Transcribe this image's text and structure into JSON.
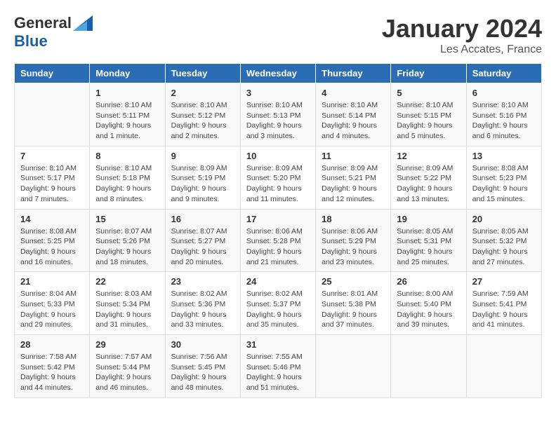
{
  "header": {
    "logo_general": "General",
    "logo_blue": "Blue",
    "month_title": "January 2024",
    "location": "Les Accates, France"
  },
  "columns": [
    "Sunday",
    "Monday",
    "Tuesday",
    "Wednesday",
    "Thursday",
    "Friday",
    "Saturday"
  ],
  "weeks": [
    [
      {
        "day": "",
        "info": ""
      },
      {
        "day": "1",
        "info": "Sunrise: 8:10 AM\nSunset: 5:11 PM\nDaylight: 9 hours\nand 1 minute."
      },
      {
        "day": "2",
        "info": "Sunrise: 8:10 AM\nSunset: 5:12 PM\nDaylight: 9 hours\nand 2 minutes."
      },
      {
        "day": "3",
        "info": "Sunrise: 8:10 AM\nSunset: 5:13 PM\nDaylight: 9 hours\nand 3 minutes."
      },
      {
        "day": "4",
        "info": "Sunrise: 8:10 AM\nSunset: 5:14 PM\nDaylight: 9 hours\nand 4 minutes."
      },
      {
        "day": "5",
        "info": "Sunrise: 8:10 AM\nSunset: 5:15 PM\nDaylight: 9 hours\nand 5 minutes."
      },
      {
        "day": "6",
        "info": "Sunrise: 8:10 AM\nSunset: 5:16 PM\nDaylight: 9 hours\nand 6 minutes."
      }
    ],
    [
      {
        "day": "7",
        "info": "Sunrise: 8:10 AM\nSunset: 5:17 PM\nDaylight: 9 hours\nand 7 minutes."
      },
      {
        "day": "8",
        "info": "Sunrise: 8:10 AM\nSunset: 5:18 PM\nDaylight: 9 hours\nand 8 minutes."
      },
      {
        "day": "9",
        "info": "Sunrise: 8:09 AM\nSunset: 5:19 PM\nDaylight: 9 hours\nand 9 minutes."
      },
      {
        "day": "10",
        "info": "Sunrise: 8:09 AM\nSunset: 5:20 PM\nDaylight: 9 hours\nand 11 minutes."
      },
      {
        "day": "11",
        "info": "Sunrise: 8:09 AM\nSunset: 5:21 PM\nDaylight: 9 hours\nand 12 minutes."
      },
      {
        "day": "12",
        "info": "Sunrise: 8:09 AM\nSunset: 5:22 PM\nDaylight: 9 hours\nand 13 minutes."
      },
      {
        "day": "13",
        "info": "Sunrise: 8:08 AM\nSunset: 5:23 PM\nDaylight: 9 hours\nand 15 minutes."
      }
    ],
    [
      {
        "day": "14",
        "info": "Sunrise: 8:08 AM\nSunset: 5:25 PM\nDaylight: 9 hours\nand 16 minutes."
      },
      {
        "day": "15",
        "info": "Sunrise: 8:07 AM\nSunset: 5:26 PM\nDaylight: 9 hours\nand 18 minutes."
      },
      {
        "day": "16",
        "info": "Sunrise: 8:07 AM\nSunset: 5:27 PM\nDaylight: 9 hours\nand 20 minutes."
      },
      {
        "day": "17",
        "info": "Sunrise: 8:06 AM\nSunset: 5:28 PM\nDaylight: 9 hours\nand 21 minutes."
      },
      {
        "day": "18",
        "info": "Sunrise: 8:06 AM\nSunset: 5:29 PM\nDaylight: 9 hours\nand 23 minutes."
      },
      {
        "day": "19",
        "info": "Sunrise: 8:05 AM\nSunset: 5:31 PM\nDaylight: 9 hours\nand 25 minutes."
      },
      {
        "day": "20",
        "info": "Sunrise: 8:05 AM\nSunset: 5:32 PM\nDaylight: 9 hours\nand 27 minutes."
      }
    ],
    [
      {
        "day": "21",
        "info": "Sunrise: 8:04 AM\nSunset: 5:33 PM\nDaylight: 9 hours\nand 29 minutes."
      },
      {
        "day": "22",
        "info": "Sunrise: 8:03 AM\nSunset: 5:34 PM\nDaylight: 9 hours\nand 31 minutes."
      },
      {
        "day": "23",
        "info": "Sunrise: 8:02 AM\nSunset: 5:36 PM\nDaylight: 9 hours\nand 33 minutes."
      },
      {
        "day": "24",
        "info": "Sunrise: 8:02 AM\nSunset: 5:37 PM\nDaylight: 9 hours\nand 35 minutes."
      },
      {
        "day": "25",
        "info": "Sunrise: 8:01 AM\nSunset: 5:38 PM\nDaylight: 9 hours\nand 37 minutes."
      },
      {
        "day": "26",
        "info": "Sunrise: 8:00 AM\nSunset: 5:40 PM\nDaylight: 9 hours\nand 39 minutes."
      },
      {
        "day": "27",
        "info": "Sunrise: 7:59 AM\nSunset: 5:41 PM\nDaylight: 9 hours\nand 41 minutes."
      }
    ],
    [
      {
        "day": "28",
        "info": "Sunrise: 7:58 AM\nSunset: 5:42 PM\nDaylight: 9 hours\nand 44 minutes."
      },
      {
        "day": "29",
        "info": "Sunrise: 7:57 AM\nSunset: 5:44 PM\nDaylight: 9 hours\nand 46 minutes."
      },
      {
        "day": "30",
        "info": "Sunrise: 7:56 AM\nSunset: 5:45 PM\nDaylight: 9 hours\nand 48 minutes."
      },
      {
        "day": "31",
        "info": "Sunrise: 7:55 AM\nSunset: 5:46 PM\nDaylight: 9 hours\nand 51 minutes."
      },
      {
        "day": "",
        "info": ""
      },
      {
        "day": "",
        "info": ""
      },
      {
        "day": "",
        "info": ""
      }
    ]
  ]
}
